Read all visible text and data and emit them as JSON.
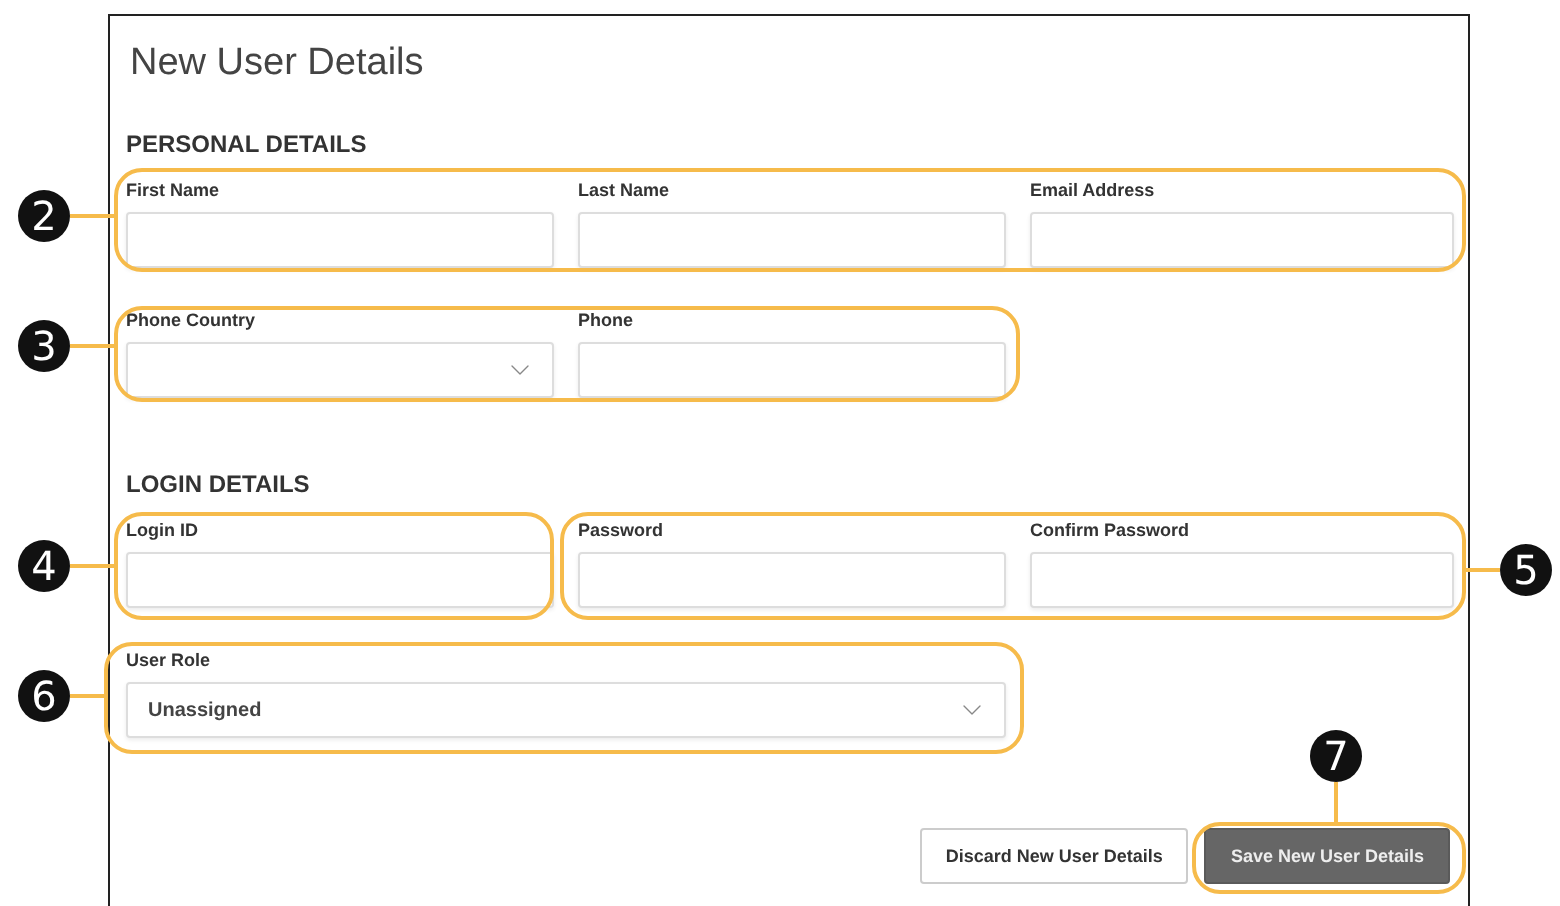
{
  "title": "New User Details",
  "sections": [
    {
      "heading": "PERSONAL DETAILS",
      "rows": [
        {
          "fields": [
            {
              "label": "First Name",
              "kind": "text"
            },
            {
              "label": "Last Name",
              "kind": "text"
            },
            {
              "label": "Email Address",
              "kind": "text"
            }
          ]
        },
        {
          "fields": [
            {
              "label": "Phone Country",
              "kind": "select"
            },
            {
              "label": "Phone",
              "kind": "text"
            }
          ]
        }
      ]
    },
    {
      "heading": "LOGIN DETAILS",
      "rows": [
        {
          "fields": [
            {
              "label": "Login ID",
              "kind": "text"
            },
            {
              "label": "Password",
              "kind": "text"
            },
            {
              "label": "Confirm Password",
              "kind": "text"
            }
          ]
        },
        {
          "fields": [
            {
              "label": "User Role",
              "kind": "select",
              "value": "Unassigned"
            }
          ]
        }
      ]
    }
  ],
  "buttons": [
    {
      "label": "Discard New User Details",
      "kind": "secondary"
    },
    {
      "label": "Save New User Details",
      "kind": "primary"
    }
  ],
  "callouts": [
    {
      "number": "2"
    },
    {
      "number": "3"
    },
    {
      "number": "4"
    },
    {
      "number": "5"
    },
    {
      "number": "6"
    },
    {
      "number": "7"
    }
  ]
}
